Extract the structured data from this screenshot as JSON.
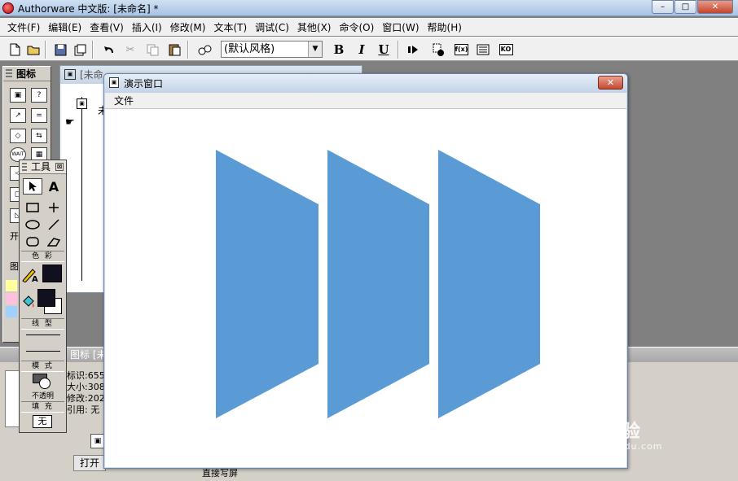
{
  "window": {
    "title": "Authorware 中文版: [未命名] *",
    "minimize": "–",
    "maximize": "□",
    "close": "✕"
  },
  "menubar": [
    "文件(F)",
    "编辑(E)",
    "查看(V)",
    "插入(I)",
    "修改(M)",
    "文本(T)",
    "调试(C)",
    "其他(X)",
    "命令(O)",
    "窗口(W)",
    "帮助(H)"
  ],
  "toolbar": {
    "style_select": "(默认风格)",
    "bold": "B",
    "italic": "I",
    "underline": "U",
    "fx": "f(x)",
    "ko": "KO"
  },
  "icon_palette": {
    "title": "图标",
    "open_label": "开",
    "color_label": "图"
  },
  "flow_window": {
    "title": "[未命",
    "flow_label": "未"
  },
  "property_panel": {
    "header": "图标 [未",
    "lines": [
      "标识:655",
      "大小:308",
      "修改:202",
      "引用: 无"
    ],
    "open_button": "打开",
    "bottom_text": "直接写屏"
  },
  "tools_palette": {
    "title": "工具",
    "close": "⊠",
    "section_color": "色 彩",
    "section_line": "线 型",
    "section_mode": "模 式",
    "mode_value": "不透明",
    "section_fill": "填 充",
    "fill_value": "无",
    "text_tool": "A"
  },
  "presentation_window": {
    "title": "演示窗口",
    "close": "✕",
    "menu_file": "文件",
    "shape_color": "#5b9bd5"
  },
  "watermark": {
    "main": "Bai 经验",
    "sub": "jingyan.baidu.com"
  }
}
